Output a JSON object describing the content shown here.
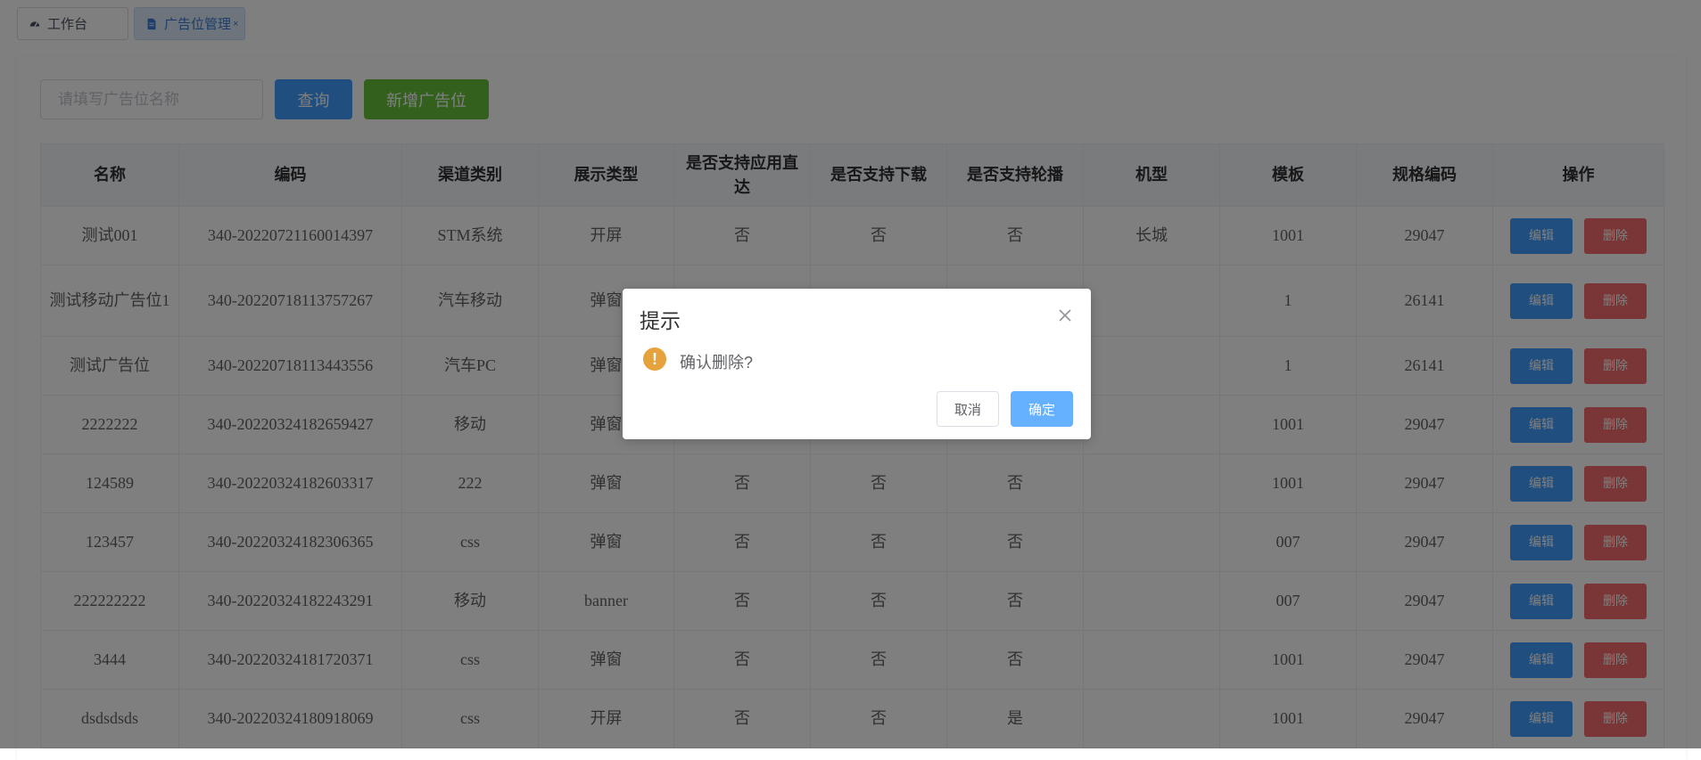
{
  "tabs": [
    {
      "label": "工作台",
      "icon": "dashboard-icon"
    },
    {
      "label": "广告位管理",
      "icon": "document-icon",
      "close": "×"
    }
  ],
  "toolbar": {
    "search_placeholder": "请填写广告位名称",
    "search_value": "",
    "query_label": "查询",
    "add_label": "新增广告位"
  },
  "table": {
    "headers": [
      "名称",
      "编码",
      "渠道类别",
      "展示类型",
      "是否支持应用直达",
      "是否支持下载",
      "是否支持轮播",
      "机型",
      "模板",
      "规格编码",
      "操作"
    ],
    "edit_label": "编辑",
    "delete_label": "删除",
    "rows": [
      [
        "测试001",
        "340-20220721160014397",
        "STM系统",
        "开屏",
        "否",
        "否",
        "否",
        "长城",
        "1001",
        "29047"
      ],
      [
        "测试移动广告位1",
        "340-20220718113757267",
        "汽车移动",
        "弹窗",
        "",
        "",
        "",
        "",
        "1",
        "26141"
      ],
      [
        "测试广告位",
        "340-20220718113443556",
        "汽车PC",
        "弹窗",
        "",
        "",
        "",
        "",
        "1",
        "26141"
      ],
      [
        "2222222",
        "340-20220324182659427",
        "移动",
        "弹窗",
        "",
        "",
        "",
        "",
        "1001",
        "29047"
      ],
      [
        "124589",
        "340-20220324182603317",
        "222",
        "弹窗",
        "否",
        "否",
        "否",
        "",
        "1001",
        "29047"
      ],
      [
        "123457",
        "340-20220324182306365",
        "css",
        "弹窗",
        "否",
        "否",
        "否",
        "",
        "007",
        "29047"
      ],
      [
        "222222222",
        "340-20220324182243291",
        "移动",
        "banner",
        "否",
        "否",
        "否",
        "",
        "007",
        "29047"
      ],
      [
        "3444",
        "340-20220324181720371",
        "css",
        "弹窗",
        "否",
        "否",
        "否",
        "",
        "1001",
        "29047"
      ],
      [
        "dsdsdsds",
        "340-20220324180918069",
        "css",
        "开屏",
        "否",
        "否",
        "是",
        "",
        "1001",
        "29047"
      ]
    ]
  },
  "dialog": {
    "title": "提示",
    "message": "确认删除?",
    "cancel_label": "取消",
    "ok_label": "确定",
    "warn_glyph": "!",
    "icon": "warning-icon",
    "accent": "#409eff",
    "warn_color": "#e6a23c",
    "danger_color": "#f56c6c",
    "success_color": "#67c23a"
  }
}
